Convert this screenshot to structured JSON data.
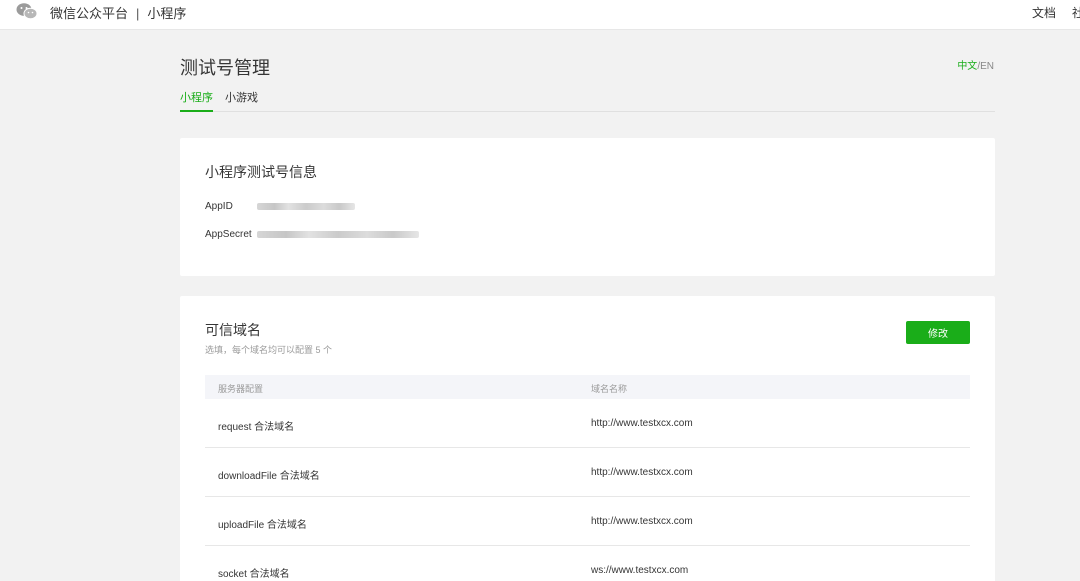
{
  "topbar": {
    "brand_main": "微信公众平台",
    "brand_sep": "|",
    "brand_sub": "小程序",
    "links": [
      "文档",
      "社"
    ],
    "logo_icon": "wechat-logo-icon"
  },
  "header": {
    "title": "测试号管理",
    "lang_zh": "中文",
    "lang_sep": "/",
    "lang_en": "EN"
  },
  "tabs": [
    {
      "label": "小程序",
      "active": true
    },
    {
      "label": "小游戏",
      "active": false
    }
  ],
  "test_account": {
    "title": "小程序测试号信息",
    "appid_label": "AppID",
    "appsecret_label": "AppSecret"
  },
  "domains": {
    "title": "可信域名",
    "hint": "选填，每个域名均可以配置 5 个",
    "edit_label": "修改",
    "columns": [
      "服务器配置",
      "域名名称"
    ],
    "rows": [
      {
        "type": "request 合法域名",
        "domain": "http://www.testxcx.com"
      },
      {
        "type": "downloadFile 合法域名",
        "domain": "http://www.testxcx.com"
      },
      {
        "type": "uploadFile 合法域名",
        "domain": "http://www.testxcx.com"
      },
      {
        "type": "socket 合法域名",
        "domain": "ws://www.testxcx.com"
      }
    ]
  },
  "colors": {
    "accent": "#1aad19",
    "background": "#f2f2f2",
    "card": "#ffffff",
    "table_header": "#f4f5f9"
  }
}
